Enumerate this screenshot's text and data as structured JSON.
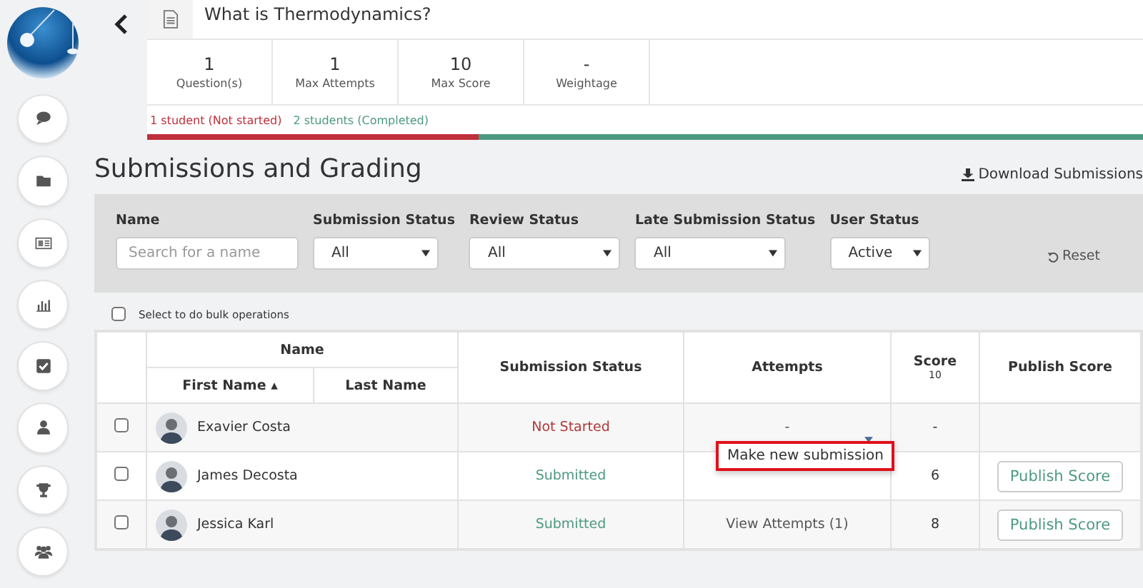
{
  "assignment": {
    "title": "What is Thermodynamics?",
    "stats": [
      {
        "value": "1",
        "label": "Question(s)"
      },
      {
        "value": "1",
        "label": "Max Attempts"
      },
      {
        "value": "10",
        "label": "Max Score"
      },
      {
        "value": "-",
        "label": "Weightage"
      }
    ],
    "progress": [
      {
        "text": "1 student (Not started)",
        "color": "#c0303b",
        "level": 0.333
      },
      {
        "text": "2 students (Completed)",
        "color": "#4e9a80",
        "level": 0.667
      }
    ]
  },
  "sidebar": {
    "items": [
      {
        "kind": "chat"
      },
      {
        "kind": "folder"
      },
      {
        "kind": "card"
      },
      {
        "kind": "chart"
      },
      {
        "kind": "check"
      },
      {
        "kind": "person"
      },
      {
        "kind": "trophy"
      },
      {
        "kind": "group"
      }
    ]
  },
  "heading": "Submissions and Grading",
  "download": "Download Submissions",
  "filters": {
    "name": {
      "label": "Name",
      "placeholder": "Search for a name"
    },
    "selects": [
      {
        "label": "Submission Status",
        "value": "All"
      },
      {
        "label": "Review Status",
        "value": "All"
      },
      {
        "label": "Late Submission Status",
        "value": "All"
      },
      {
        "label": "User Status",
        "value": "Active"
      }
    ],
    "reset": "Reset"
  },
  "bulk": {
    "label": "Select to do bulk operations",
    "checked": false
  },
  "table": {
    "columns": {
      "name": "Name",
      "first_name": "First Name ▴",
      "last_name": "Last Name",
      "status": "Submission Status",
      "attempts": "Attempts",
      "score": "Score",
      "score_max": "10",
      "publish": "Publish Score"
    },
    "rows": [
      {
        "checked": false,
        "name": "Exavier Costa",
        "status": "Not Started",
        "kind": "pending",
        "attempts": "-",
        "score": "-",
        "menu": true
      },
      {
        "checked": false,
        "name": "James Decosta",
        "status": "Submitted",
        "kind": "done",
        "score": "6",
        "publish": "Publish Score"
      },
      {
        "checked": false,
        "name": "Jessica Karl",
        "status": "Submitted",
        "kind": "done",
        "attempts": "View Attempts (1)",
        "score": "8",
        "publish": "Publish Score"
      }
    ]
  },
  "popup": {
    "label": "Make new submission"
  }
}
